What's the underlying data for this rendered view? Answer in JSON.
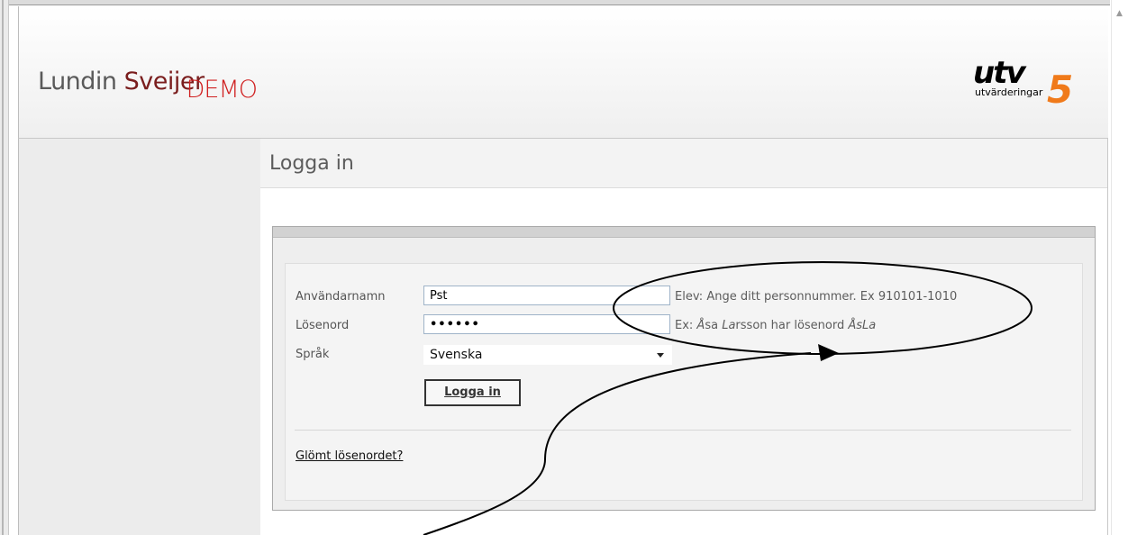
{
  "header": {
    "logo_left_main": "Lundin ",
    "logo_left_accent": "Sveijer",
    "logo_left_badge": "DEMO",
    "logo_right_mark": "utv",
    "logo_right_number": "5",
    "logo_right_sub": "utvärderingar"
  },
  "page": {
    "title": "Logga in"
  },
  "form": {
    "username_label": "Användarnamn",
    "username_value": "Pst",
    "username_hint": "Elev: Ange ditt personnummer. Ex 910101-1010",
    "password_label": "Lösenord",
    "password_value": "••••••",
    "password_hint_prefix": "Ex: ",
    "password_hint_name1": "Å",
    "password_hint_name1_rest": "sa ",
    "password_hint_name2": "La",
    "password_hint_name2_rest": "rsson",
    "password_hint_middle": " har lösenord ",
    "password_hint_result": "ÅsLa",
    "language_label": "Språk",
    "language_value": "Svenska",
    "submit_label": "Logga in",
    "forgot_link": "Glömt lösenordet?"
  }
}
